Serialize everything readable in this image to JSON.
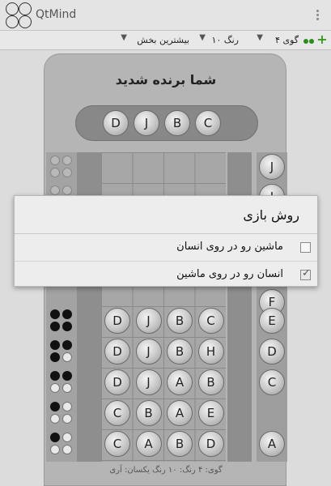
{
  "app": {
    "title": "QtMind",
    "logo_colors": [
      "#2233cc",
      "#dd2222",
      "#22aa22",
      "#e6d21a"
    ]
  },
  "toolbar": {
    "options": [
      "گوی ۴",
      "رنگ ۱۰",
      "بیشترین بخش"
    ]
  },
  "board": {
    "win_title": "شما برنده شدید",
    "solution": [
      "D",
      "J",
      "B",
      "C"
    ],
    "guesses": [
      [
        "D",
        "J",
        "B",
        "C"
      ],
      [
        "D",
        "J",
        "B",
        "H"
      ],
      [
        "D",
        "J",
        "A",
        "B"
      ],
      [
        "C",
        "B",
        "A",
        "E"
      ],
      [
        "C",
        "A",
        "B",
        "D"
      ]
    ],
    "letter_column": [
      "J",
      "I",
      "E",
      "D",
      "C",
      "A",
      "F"
    ],
    "status": "گوی: ۴   رنگ: ۱۰   رنگ یکسان: آری"
  },
  "dialog": {
    "title": "روش بازی",
    "options": [
      {
        "label": "ماشین رو در روی انسان",
        "checked": false
      },
      {
        "label": "انسان رو در روی ماشین",
        "checked": true
      }
    ]
  },
  "hint_rows": [
    {
      "pegs": [
        "black",
        "black",
        "black",
        "black"
      ]
    },
    {
      "pegs": [
        "black",
        "black",
        "black",
        "white"
      ]
    },
    {
      "pegs": [
        "black",
        "black",
        "white",
        "white"
      ]
    },
    {
      "pegs": [
        "black",
        "white",
        "white",
        "white"
      ]
    },
    {
      "pegs": [
        "black",
        "white",
        "white",
        "white"
      ]
    }
  ]
}
